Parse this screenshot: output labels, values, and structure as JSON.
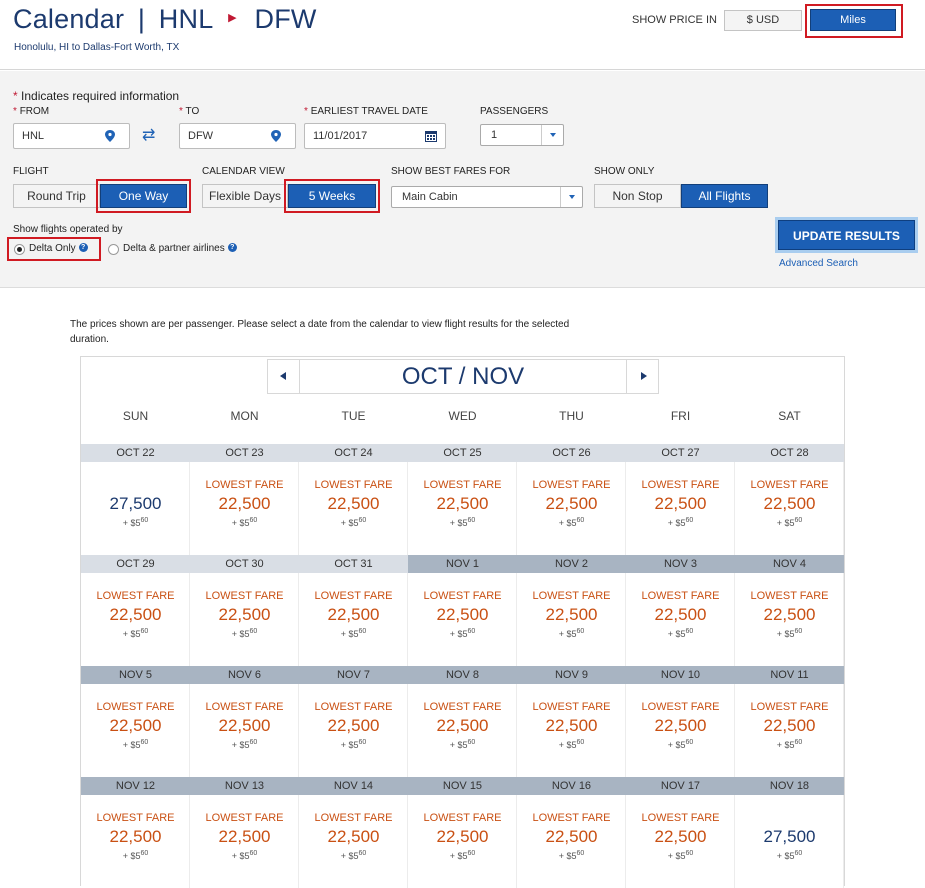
{
  "header": {
    "title_prefix": "Calendar",
    "title_sep": "|",
    "origin": "HNL",
    "destination": "DFW",
    "subtitle": "Honolulu, HI to Dallas-Fort Worth, TX",
    "price_label": "SHOW PRICE IN",
    "usd_label": "$ USD",
    "miles_label": "Miles"
  },
  "form": {
    "required_star": "*",
    "required_note": "Indicates required information",
    "from_label": "FROM",
    "from_value": "HNL",
    "to_label": "TO",
    "to_value": "DFW",
    "date_label": "EARLIEST TRAVEL DATE",
    "date_value": "11/01/2017",
    "passengers_label": "PASSENGERS",
    "passengers_value": "1",
    "flight_label": "FLIGHT",
    "round_trip": "Round Trip",
    "one_way": "One Way",
    "calendar_view_label": "CALENDAR VIEW",
    "flexible_days": "Flexible Days",
    "five_weeks": "5 Weeks",
    "best_fares_label": "SHOW BEST FARES FOR",
    "best_fares_value": "Main Cabin",
    "show_only_label": "SHOW ONLY",
    "non_stop": "Non Stop",
    "all_flights": "All Flights",
    "operated_label": "Show flights operated by",
    "delta_only": "Delta Only",
    "delta_partner": "Delta & partner airlines",
    "help": "?",
    "update_button": "UPDATE RESULTS",
    "advanced_search": "Advanced Search"
  },
  "calendar": {
    "note": "The prices shown are per passenger. Please select a date from the calendar to view flight results for the selected duration.",
    "month_title": "OCT / NOV",
    "weekdays": [
      "SUN",
      "MON",
      "TUE",
      "WED",
      "THU",
      "FRI",
      "SAT"
    ],
    "lowest_label": "LOWEST FARE",
    "tax_prefix": "+ $",
    "tax_dollars": "5",
    "tax_cents": "60",
    "weeks": [
      [
        {
          "date": "OCT 22",
          "miles": "27,500",
          "lowest": false,
          "nov": false
        },
        {
          "date": "OCT 23",
          "miles": "22,500",
          "lowest": true,
          "nov": false
        },
        {
          "date": "OCT 24",
          "miles": "22,500",
          "lowest": true,
          "nov": false
        },
        {
          "date": "OCT 25",
          "miles": "22,500",
          "lowest": true,
          "nov": false
        },
        {
          "date": "OCT 26",
          "miles": "22,500",
          "lowest": true,
          "nov": false
        },
        {
          "date": "OCT 27",
          "miles": "22,500",
          "lowest": true,
          "nov": false
        },
        {
          "date": "OCT 28",
          "miles": "22,500",
          "lowest": true,
          "nov": false
        }
      ],
      [
        {
          "date": "OCT 29",
          "miles": "22,500",
          "lowest": true,
          "nov": false
        },
        {
          "date": "OCT 30",
          "miles": "22,500",
          "lowest": true,
          "nov": false
        },
        {
          "date": "OCT 31",
          "miles": "22,500",
          "lowest": true,
          "nov": false
        },
        {
          "date": "NOV 1",
          "miles": "22,500",
          "lowest": true,
          "nov": true
        },
        {
          "date": "NOV 2",
          "miles": "22,500",
          "lowest": true,
          "nov": true
        },
        {
          "date": "NOV 3",
          "miles": "22,500",
          "lowest": true,
          "nov": true
        },
        {
          "date": "NOV 4",
          "miles": "22,500",
          "lowest": true,
          "nov": true
        }
      ],
      [
        {
          "date": "NOV 5",
          "miles": "22,500",
          "lowest": true,
          "nov": true
        },
        {
          "date": "NOV 6",
          "miles": "22,500",
          "lowest": true,
          "nov": true
        },
        {
          "date": "NOV 7",
          "miles": "22,500",
          "lowest": true,
          "nov": true
        },
        {
          "date": "NOV 8",
          "miles": "22,500",
          "lowest": true,
          "nov": true
        },
        {
          "date": "NOV 9",
          "miles": "22,500",
          "lowest": true,
          "nov": true
        },
        {
          "date": "NOV 10",
          "miles": "22,500",
          "lowest": true,
          "nov": true
        },
        {
          "date": "NOV 11",
          "miles": "22,500",
          "lowest": true,
          "nov": true
        }
      ],
      [
        {
          "date": "NOV 12",
          "miles": "22,500",
          "lowest": true,
          "nov": true
        },
        {
          "date": "NOV 13",
          "miles": "22,500",
          "lowest": true,
          "nov": true
        },
        {
          "date": "NOV 14",
          "miles": "22,500",
          "lowest": true,
          "nov": true
        },
        {
          "date": "NOV 15",
          "miles": "22,500",
          "lowest": true,
          "nov": true
        },
        {
          "date": "NOV 16",
          "miles": "22,500",
          "lowest": true,
          "nov": true
        },
        {
          "date": "NOV 17",
          "miles": "22,500",
          "lowest": true,
          "nov": true
        },
        {
          "date": "NOV 18",
          "miles": "27,500",
          "lowest": false,
          "nov": true
        }
      ]
    ]
  },
  "colors": {
    "brand_navy": "#1c3a6e",
    "button_blue": "#1c5fb5",
    "lowest_fare_orange": "#c95013",
    "highlight_red": "#d01a22"
  }
}
